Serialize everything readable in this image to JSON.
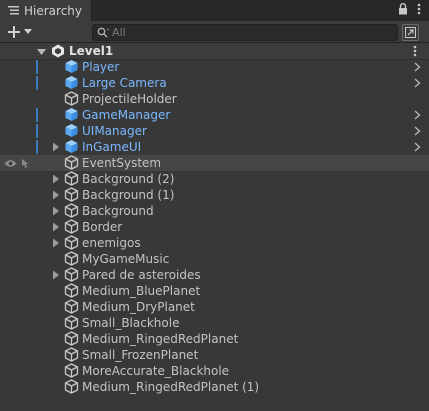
{
  "window": {
    "tab_title": "Hierarchy"
  },
  "icons": {
    "tab": "hierarchy-lines-icon",
    "lock": "lock-icon",
    "menu": "kebab-menu-icon",
    "add": "plus-icon",
    "dropdown": "chevron-down-icon",
    "search": "search-icon",
    "pick": "scene-pick-icon"
  },
  "colors": {
    "prefab_text": "#7ab8ff",
    "prefab_bar": "#3a79bb",
    "normal_text": "#c4c4c4",
    "background": "#383838"
  },
  "search": {
    "placeholder": "All"
  },
  "scene": {
    "name": "Level1"
  },
  "items": [
    {
      "label": "Player",
      "prefab": true,
      "foldout": false,
      "has_child_arrow": true
    },
    {
      "label": "Large Camera",
      "prefab": true,
      "foldout": false,
      "has_child_arrow": true
    },
    {
      "label": "ProjectileHolder",
      "prefab": false,
      "foldout": false,
      "has_child_arrow": false
    },
    {
      "label": "GameManager",
      "prefab": true,
      "foldout": false,
      "has_child_arrow": true
    },
    {
      "label": "UIManager",
      "prefab": true,
      "foldout": false,
      "has_child_arrow": true
    },
    {
      "label": "InGameUI",
      "prefab": true,
      "foldout": true,
      "has_child_arrow": true
    },
    {
      "label": "EventSystem",
      "prefab": false,
      "foldout": false,
      "has_child_arrow": false,
      "hovered": true
    },
    {
      "label": "Background (2)",
      "prefab": false,
      "foldout": true,
      "has_child_arrow": false
    },
    {
      "label": "Background (1)",
      "prefab": false,
      "foldout": true,
      "has_child_arrow": false
    },
    {
      "label": "Background",
      "prefab": false,
      "foldout": true,
      "has_child_arrow": false
    },
    {
      "label": "Border",
      "prefab": false,
      "foldout": true,
      "has_child_arrow": false
    },
    {
      "label": "enemigos",
      "prefab": false,
      "foldout": true,
      "has_child_arrow": false
    },
    {
      "label": "MyGameMusic",
      "prefab": false,
      "foldout": false,
      "has_child_arrow": false
    },
    {
      "label": "Pared de asteroides",
      "prefab": false,
      "foldout": true,
      "has_child_arrow": false
    },
    {
      "label": "Medium_BluePlanet",
      "prefab": false,
      "foldout": false,
      "has_child_arrow": false
    },
    {
      "label": "Medium_DryPlanet",
      "prefab": false,
      "foldout": false,
      "has_child_arrow": false
    },
    {
      "label": "Small_Blackhole",
      "prefab": false,
      "foldout": false,
      "has_child_arrow": false
    },
    {
      "label": "Medium_RingedRedPlanet",
      "prefab": false,
      "foldout": false,
      "has_child_arrow": false
    },
    {
      "label": "Small_FrozenPlanet",
      "prefab": false,
      "foldout": false,
      "has_child_arrow": false
    },
    {
      "label": "MoreAccurate_Blackhole",
      "prefab": false,
      "foldout": false,
      "has_child_arrow": false
    },
    {
      "label": "Medium_RingedRedPlanet (1)",
      "prefab": false,
      "foldout": false,
      "has_child_arrow": false
    }
  ]
}
